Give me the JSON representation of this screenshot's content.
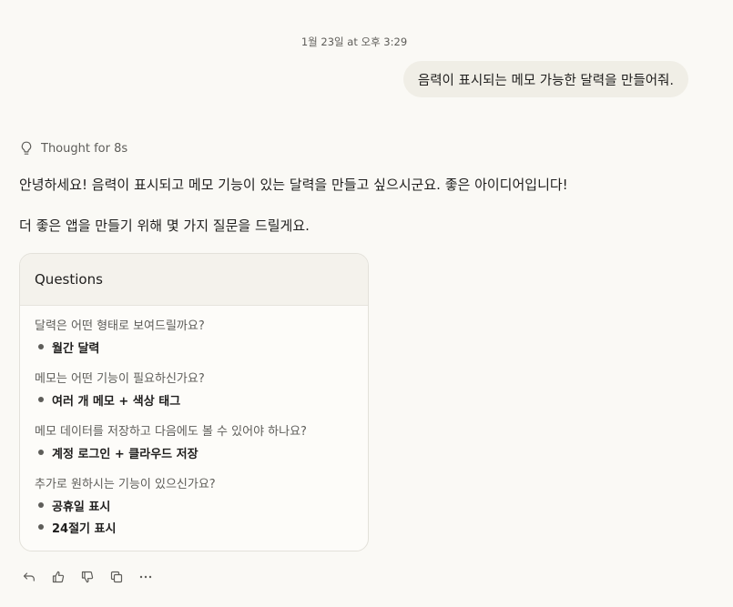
{
  "conversation": {
    "timestamp": "1월 23일 at 오후 3:29",
    "user_message": "음력이 표시되는 메모 가능한 달력을 만들어줘."
  },
  "response": {
    "thought_label": "Thought for 8s",
    "paragraph_1": "안녕하세요! 음력이 표시되고 메모 기능이 있는 달력을 만들고 싶으시군요. 좋은 아이디어입니다!",
    "paragraph_2": "더 좋은 앱을 만들기 위해 몇 가지 질문을 드릴게요."
  },
  "questions_card": {
    "title": "Questions",
    "items": [
      {
        "question": "달력은 어떤 형태로 보여드릴까요?",
        "answers": [
          "월간 달력"
        ]
      },
      {
        "question": "메모는 어떤 기능이 필요하신가요?",
        "answers": [
          "여러 개 메모 + 색상 태그"
        ]
      },
      {
        "question": "메모 데이터를 저장하고 다음에도 볼 수 있어야 하나요?",
        "answers": [
          "계정 로그인 + 클라우드 저장"
        ]
      },
      {
        "question": "추가로 원하시는 기능이 있으신가요?",
        "answers": [
          "공휴일 표시",
          "24절기 표시"
        ]
      }
    ]
  },
  "actions": {
    "icons": [
      "undo-icon",
      "thumbs-up-icon",
      "thumbs-down-icon",
      "copy-icon",
      "more-icon"
    ]
  },
  "colors": {
    "background": "#faf9f5",
    "bubble": "#f0eee6",
    "muted_text": "#5e5d59",
    "primary_text": "#1f1e1d",
    "card_header": "#f4f2ec",
    "card_border": "#e3e1da"
  }
}
